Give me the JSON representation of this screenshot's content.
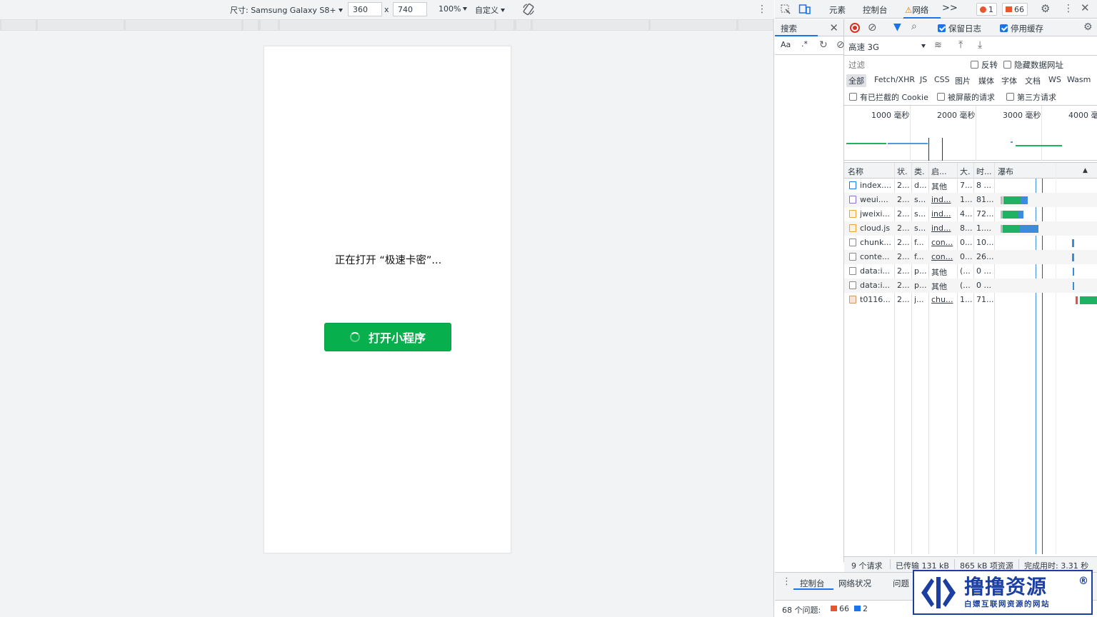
{
  "emulation": {
    "device_label": "尺寸: Samsung Galaxy S8+",
    "width": "360",
    "times": "x",
    "height": "740",
    "zoom": "100%",
    "throttle_preset": "自定义"
  },
  "page": {
    "opening_text": "正在打开 “极速卡密”...",
    "open_button": "打开小程序"
  },
  "devtools": {
    "tabs": [
      "元素",
      "控制台",
      "网络"
    ],
    "more_tabs": ">>",
    "error_count": "1",
    "warning_count": "66",
    "search_tab": "搜索",
    "search_aa": "Aa",
    "search_regex": ".*",
    "network": {
      "preserve_log": "保留日志",
      "disable_cache": "停用缓存",
      "throttle": "高速 3G",
      "filter_placeholder": "过滤",
      "invert": "反转",
      "hide_data_urls": "隐藏数据网址",
      "types": [
        "全部",
        "Fetch/XHR",
        "JS",
        "CSS",
        "图片",
        "媒体",
        "字体",
        "文档",
        "WS",
        "Wasm"
      ],
      "blocked_cookies": "有已拦截的 Cookie",
      "blocked_requests": "被屏蔽的请求",
      "third_party": "第三方请求",
      "timeline_ticks": [
        "1000 毫秒",
        "2000 毫秒",
        "3000 毫秒",
        "4000 毫"
      ],
      "columns": [
        "名称",
        "状.",
        "类.",
        "启...",
        "大.",
        "时...",
        "瀑布"
      ],
      "rows": [
        {
          "name": "index....",
          "status": "2...",
          "type": "d...",
          "initiator": "其他",
          "size": "7...",
          "time": "8 ...",
          "icon": "doc"
        },
        {
          "name": "weui....",
          "status": "2...",
          "type": "s...",
          "initiator": "ind...",
          "size": "1...",
          "time": "81...",
          "icon": "css"
        },
        {
          "name": "jweixi...",
          "status": "2...",
          "type": "s...",
          "initiator": "ind...",
          "size": "4...",
          "time": "72...",
          "icon": "js"
        },
        {
          "name": "cloud.js",
          "status": "2...",
          "type": "s...",
          "initiator": "ind...",
          "size": "8...",
          "time": "1....",
          "icon": "js"
        },
        {
          "name": "chunk...",
          "status": "2...",
          "type": "f...",
          "initiator": "con...",
          "size": "0...",
          "time": "10...",
          "icon": "file"
        },
        {
          "name": "conte...",
          "status": "2...",
          "type": "f...",
          "initiator": "con...",
          "size": "0...",
          "time": "26...",
          "icon": "file"
        },
        {
          "name": "data:i...",
          "status": "2...",
          "type": "p...",
          "initiator": "其他",
          "size": "(...",
          "time": "0 ...",
          "icon": "file"
        },
        {
          "name": "data:i...",
          "status": "2...",
          "type": "p...",
          "initiator": "其他",
          "size": "(...",
          "time": "0 ...",
          "icon": "file"
        },
        {
          "name": "t0116...",
          "status": "2...",
          "type": "j...",
          "initiator": "chu...",
          "size": "1...",
          "time": "71...",
          "icon": "img"
        }
      ],
      "status_requests": "9 个请求",
      "status_transferred": "已传输 131 kB",
      "status_resources": "865 kB 项资源",
      "status_finish": "完成用时: 3.31 秒"
    },
    "drawer": {
      "tab_console": "控制台",
      "tab_network_conditions": "网络状况",
      "tab_issues": "问题",
      "issues_label": "68 个问题:",
      "issues_warn": "66",
      "issues_info": "2"
    }
  },
  "watermark": {
    "title": "撸撸资源",
    "subtitle": "白嫖互联网资源的网站",
    "reg": "®"
  },
  "colors": {
    "accent_green": "#07b04c",
    "devtools_blue": "#1a73e8",
    "watermark_blue": "#1b3fa0"
  }
}
